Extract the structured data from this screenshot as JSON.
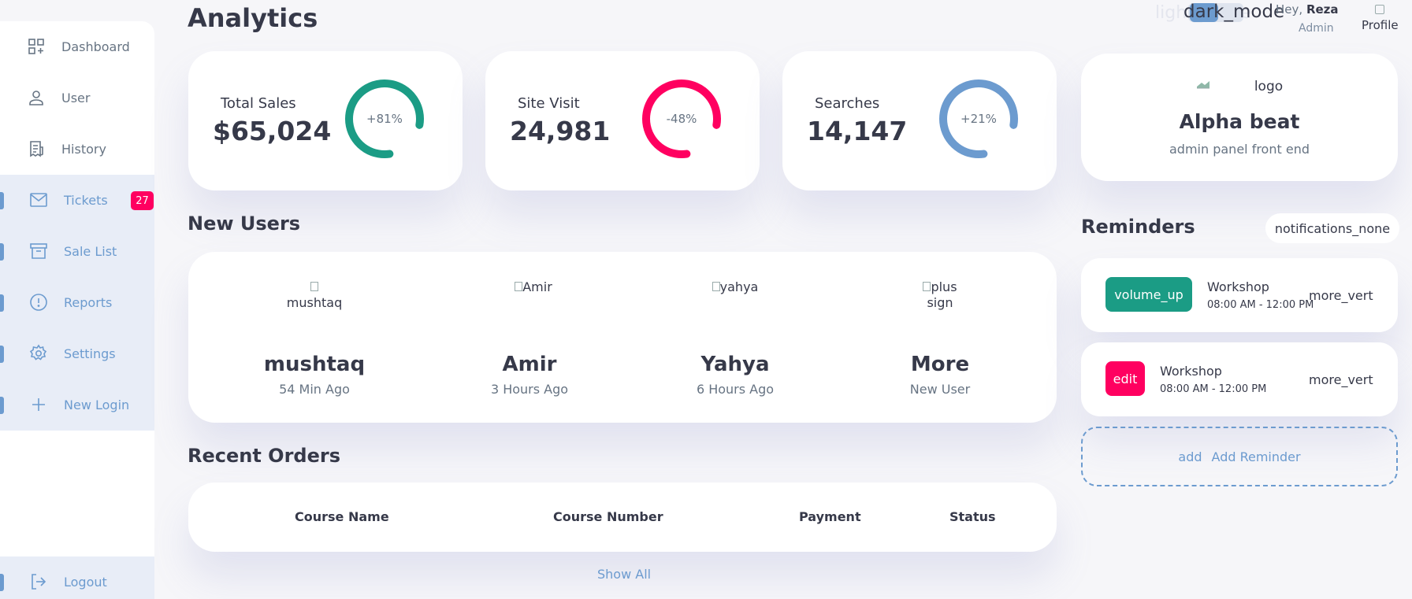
{
  "sidebar": {
    "items": [
      {
        "label": "Dashboard",
        "icon": "dashboard-icon"
      },
      {
        "label": "User",
        "icon": "user-icon"
      },
      {
        "label": "History",
        "icon": "receipt-icon"
      },
      {
        "label": "Tickets",
        "icon": "mail-icon",
        "badge": "27"
      },
      {
        "label": "Sale List",
        "icon": "inventory-icon"
      },
      {
        "label": "Reports",
        "icon": "report-icon"
      },
      {
        "label": "Settings",
        "icon": "settings-icon"
      },
      {
        "label": "New Login",
        "icon": "add-icon"
      }
    ],
    "logout": {
      "label": "Logout",
      "icon": "logout-icon"
    }
  },
  "header": {
    "title": "Analytics",
    "theme_light": "light_mode",
    "theme_dark": "dark_mode",
    "greeting": "Hey,",
    "user_name": "Reza",
    "user_role": "Admin",
    "profile_alt": "Profile"
  },
  "analytics": [
    {
      "name": "Total Sales",
      "value": "$65,024",
      "percent_label": "+81%",
      "ring_color": "#1b9c85"
    },
    {
      "name": "Site Visit",
      "value": "24,981",
      "percent_label": "-48%",
      "ring_color": "#ff0060"
    },
    {
      "name": "Searches",
      "value": "14,147",
      "percent_label": "+21%",
      "ring_color": "#6c9bcf"
    }
  ],
  "brand": {
    "logo_alt": "logo",
    "name": "Alpha beat",
    "subtitle": "admin panel front end"
  },
  "new_users": {
    "heading": "New Users",
    "users": [
      {
        "img_alt": "mushtaq",
        "name": "mushtaq",
        "time": "54 Min Ago"
      },
      {
        "img_alt": "Amir",
        "name": "Amir",
        "time": "3 Hours Ago"
      },
      {
        "img_alt": "yahya",
        "name": "Yahya",
        "time": "6 Hours Ago"
      },
      {
        "img_alt": "plus sign",
        "name": "More",
        "time": "New User"
      }
    ]
  },
  "recent_orders": {
    "heading": "Recent Orders",
    "columns": [
      "Course Name",
      "Course Number",
      "Payment",
      "Status"
    ],
    "show_all": "Show All"
  },
  "reminders": {
    "heading": "Reminders",
    "notif_icon": "notifications_none",
    "items": [
      {
        "icon_text": "volume_up",
        "icon_color": "#1b9c85",
        "title": "Workshop",
        "time": "08:00 AM - 12:00 PM",
        "more": "more_vert"
      },
      {
        "icon_text": "edit",
        "icon_color": "#ff0060",
        "title": "Workshop",
        "time": "08:00 AM - 12:00 PM",
        "more": "more_vert"
      }
    ],
    "add_icon": "add",
    "add_label": "Add Reminder"
  },
  "colors": {
    "primary": "#6c9bcf",
    "success": "#1b9c85",
    "danger": "#ff0060",
    "background": "#f6f6f9"
  }
}
